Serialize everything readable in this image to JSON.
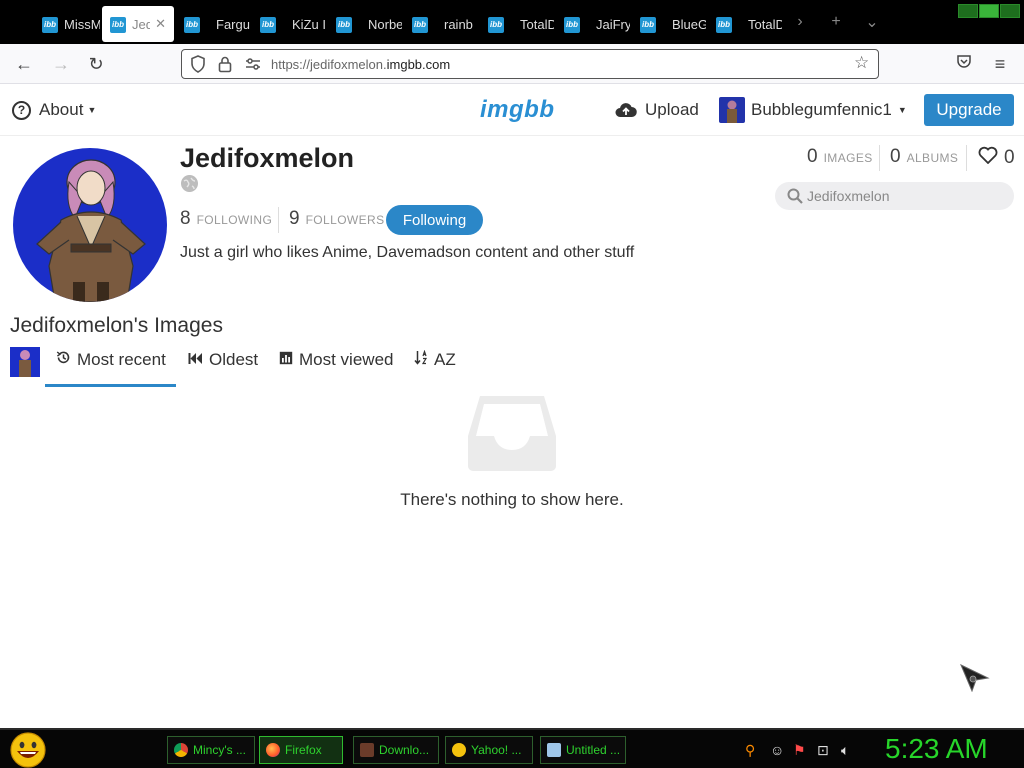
{
  "browser": {
    "tabs": [
      {
        "label": "MissM",
        "favicon": "ibb"
      },
      {
        "label": "Jedi",
        "favicon": "ibb",
        "active": true
      },
      {
        "label": "Fargus",
        "favicon": "ibb"
      },
      {
        "label": "KiZu I",
        "favicon": "ibb"
      },
      {
        "label": "Norbe",
        "favicon": "ibb"
      },
      {
        "label": "rainb",
        "favicon": "ibb"
      },
      {
        "label": "TotalD",
        "favicon": "ibb"
      },
      {
        "label": "JaiFry",
        "favicon": "ibb"
      },
      {
        "label": "BlueG",
        "favicon": "ibb"
      },
      {
        "label": "TotalD",
        "favicon": "ibb"
      }
    ],
    "url_prefix": "https://jedifoxmelon.",
    "url_domain": "imgbb.com"
  },
  "header": {
    "about_label": "About",
    "logo_text": "imgbb",
    "upload_label": "Upload",
    "user_name": "Bubblegumfennic1",
    "upgrade_label": "Upgrade"
  },
  "profile": {
    "name": "Jedifoxmelon",
    "following_count": "8",
    "following_label": "FOLLOWING",
    "followers_count": "9",
    "followers_label": "FOLLOWERS",
    "follow_button": "Following",
    "bio": "Just a girl who likes Anime, Davemadson content and other stuff",
    "images_count": "0",
    "images_label": "IMAGES",
    "albums_count": "0",
    "albums_label": "ALBUMS",
    "likes_count": "0",
    "search_placeholder": "Jedifoxmelon"
  },
  "images_section": {
    "title": "Jedifoxmelon's Images",
    "sort_tabs": [
      "Most recent",
      "Oldest",
      "Most viewed",
      "AZ"
    ],
    "active_sort": "Most recent",
    "empty_message": "There's nothing to show here."
  },
  "taskbar": {
    "buttons": [
      "Mincy's ...",
      "Firefox",
      "Downlo...",
      "Yahoo! ...",
      "Untitled ..."
    ],
    "active_button": "Firefox",
    "clock": "5:23 AM"
  },
  "colors": {
    "accent": "#2b87c8",
    "logo": "#2a8fd3",
    "clock": "#27d62a",
    "avatar_bg": "#1b2ec8"
  }
}
